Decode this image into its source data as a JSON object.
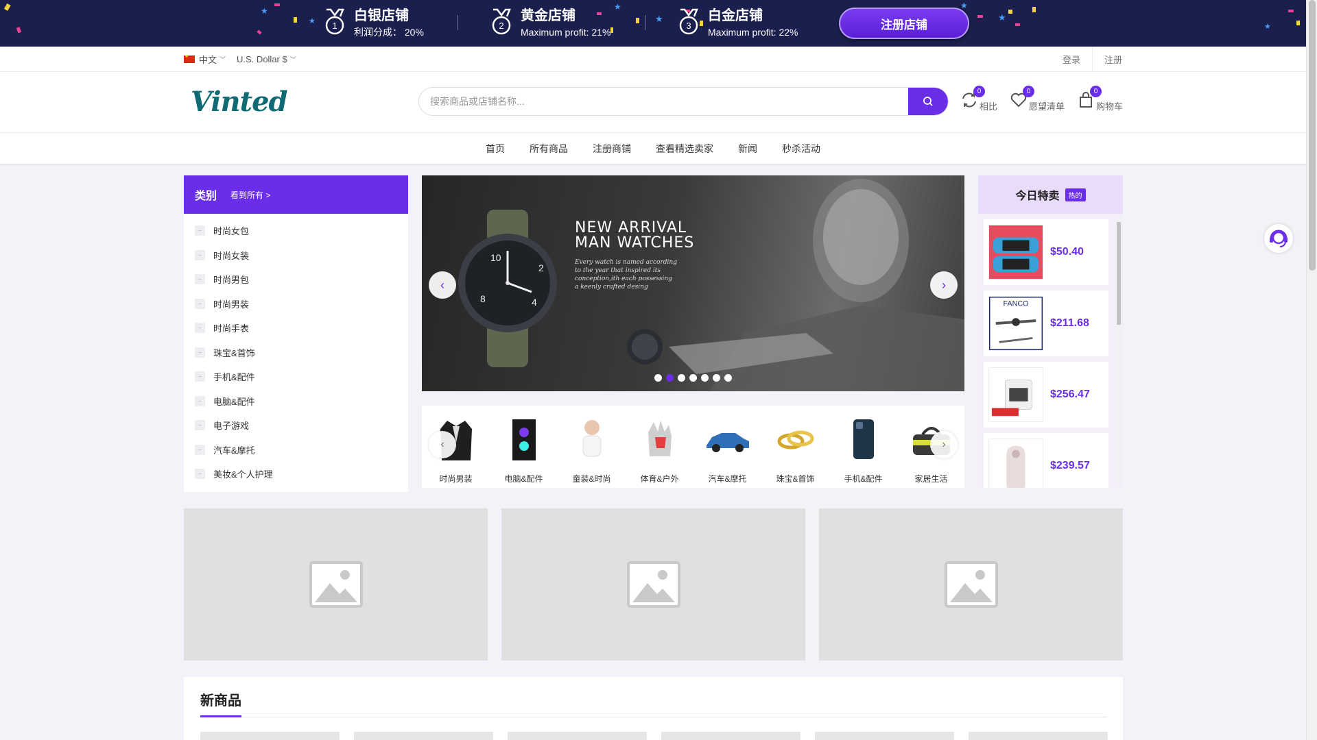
{
  "banner": {
    "tiers": [
      {
        "title": "白银店铺",
        "sub": "利润分成： 20%",
        "num": "1"
      },
      {
        "title": "黄金店铺",
        "sub": "Maximum profit: 21%",
        "num": "2"
      },
      {
        "title": "白金店铺",
        "sub": "Maximum profit: 22%",
        "num": "3"
      }
    ],
    "register_shop": "注册店铺"
  },
  "util": {
    "language": "中文",
    "currency": "U.S. Dollar $",
    "login": "登录",
    "register": "注册"
  },
  "header": {
    "logo": "Vinted",
    "search_placeholder": "搜索商品或店铺名称...",
    "compare": {
      "label": "相比",
      "count": "0"
    },
    "wishlist": {
      "label": "愿望清单",
      "count": "0"
    },
    "cart": {
      "label": "购物车",
      "count": "0"
    }
  },
  "nav": [
    "首页",
    "所有商品",
    "注册商铺",
    "查看精选卖家",
    "新闻",
    "秒杀活动"
  ],
  "categories": {
    "title": "类别",
    "see_all": "看到所有 >",
    "items": [
      "时尚女包",
      "时尚女装",
      "时尚男包",
      "时尚男装",
      "时尚手表",
      "珠宝&首饰",
      "手机&配件",
      "电脑&配件",
      "电子游戏",
      "汽车&摩托",
      "美妆&个人护理"
    ]
  },
  "hero": {
    "title_line1": "NEW ARRIVAL",
    "title_line2": "MAN WATCHES",
    "description": "Every watch is named according to the year that inspired its conception,ith each possessing a keenly crafted desing",
    "slide_count": 7,
    "active_slide": 1
  },
  "mini_categories": [
    "时尚男装",
    "电脑&配件",
    "童装&时尚",
    "体育&户外",
    "汽车&摩托",
    "珠宝&首饰",
    "手机&配件",
    "家居生活"
  ],
  "today": {
    "title": "今日特卖",
    "hot": "热的",
    "deals": [
      {
        "price": "$50.40"
      },
      {
        "price": "$211.68",
        "brand": "FANCO"
      },
      {
        "price": "$256.47"
      },
      {
        "price": "$239.57"
      }
    ]
  },
  "new_products": {
    "title": "新商品"
  },
  "colors": {
    "accent": "#6a2ee8",
    "banner_bg": "#1a1f4d",
    "logo": "#0f6a73"
  }
}
